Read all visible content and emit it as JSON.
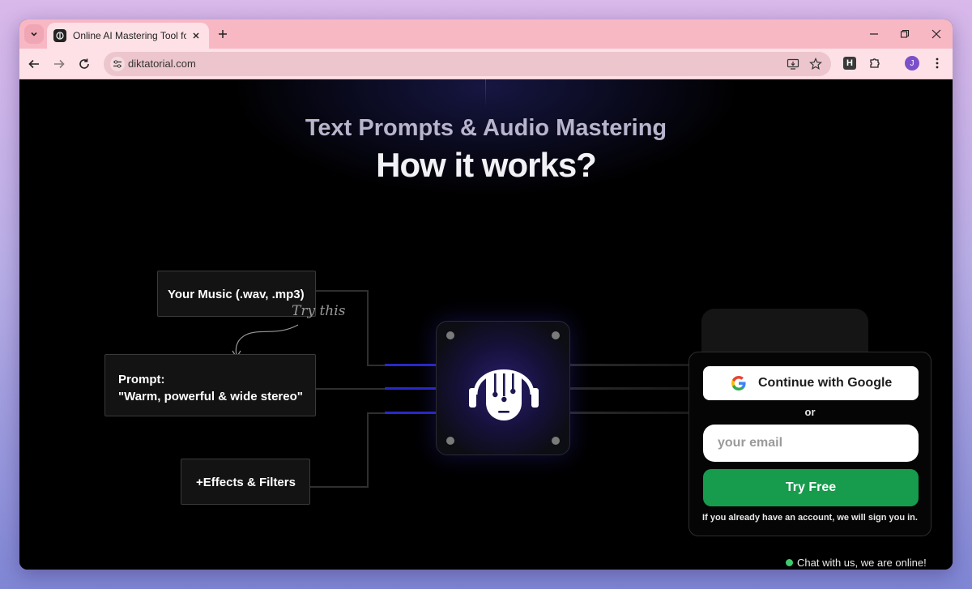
{
  "browser": {
    "tab_title": "Online AI Mastering Tool for Au",
    "url": "diktatorial.com",
    "avatar_initial": "J",
    "extension_letter": "H"
  },
  "page": {
    "eyebrow": "Text Prompts & Audio Mastering",
    "headline": "How it works?",
    "inputs": {
      "music": "Your Music (.wav, .mp3)",
      "prompt_label": "Prompt:",
      "prompt_text": "\"Warm, powerful & wide stereo\"",
      "effects": "+Effects & Filters",
      "try_this": "Try this"
    },
    "signup": {
      "google_label": "Continue with Google",
      "or_label": "or",
      "email_placeholder": "your email",
      "try_free_label": "Try Free",
      "note": "If you already have an account, we will sign you in."
    },
    "chat_label": "Chat with us, we are online!"
  },
  "colors": {
    "tab_strip": "#f7b8c4",
    "toolbar": "#fde1e6",
    "accent_blue": "#2a28c9",
    "cta_green": "#179b4c",
    "online_dot": "#3ecb6b"
  }
}
